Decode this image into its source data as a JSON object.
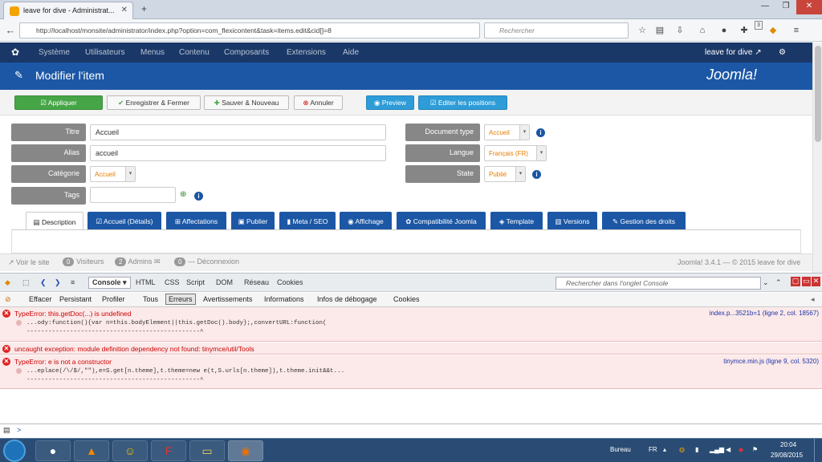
{
  "browser": {
    "tab_title": "leave for dive - Administrat...",
    "url": "http://localhost/monsite/administrator/index.php?option=com_flexicontent&task=items.edit&cid[]=8",
    "search_placeholder": "Rechercher",
    "badge_count": "3"
  },
  "joomla_menu": [
    "Système",
    "Utilisateurs",
    "Menus",
    "Contenu",
    "Composants",
    "Extensions",
    "Aide"
  ],
  "site_name": "leave for dive ↗",
  "page_title": "Modifier l'item",
  "brand": "Joomla!",
  "toolbar": {
    "apply": "Appliquer",
    "save_close": "Enregistrer & Fermer",
    "save_new": "Sauver & Nouveau",
    "cancel": "Annuler",
    "preview": "Preview",
    "edit_positions": "Editer les positions"
  },
  "form": {
    "title_label": "Titre",
    "title_value": "Accueil",
    "alias_label": "Alias",
    "alias_value": "accueil",
    "category_label": "Catégorie",
    "category_value": "Accueil",
    "tags_label": "Tags",
    "doctype_label": "Document type",
    "doctype_value": "Accueil",
    "language_label": "Langue",
    "language_value": "Français (FR)",
    "state_label": "State",
    "state_value": "Publié"
  },
  "tabs": [
    "Description",
    "Accueil (Détails)",
    "Affectations",
    "Publier",
    "Meta / SEO",
    "Affichage",
    "Compatibilité Joomla",
    "Template",
    "Versions",
    "Gestion des droits"
  ],
  "status": {
    "view_site": "Voir le site",
    "visitors_count": "0",
    "visitors": "Visiteurs",
    "admins_count": "2",
    "admins": "Admins",
    "messages_count": "0",
    "logout": "Déconnexion",
    "footer": "Joomla! 3.4.1 — © 2015 leave for dive"
  },
  "firebug": {
    "tabs": [
      "Console ▾",
      "HTML",
      "CSS",
      "Script",
      "DOM",
      "Réseau",
      "Cookies"
    ],
    "search_placeholder": "Rechercher dans l'onglet Console",
    "filters": [
      "Effacer",
      "Persistant",
      "Profiler",
      "Tous",
      "Erreurs",
      "Avertissements",
      "Informations",
      "Infos de débogage",
      "Cookies"
    ]
  },
  "errors": [
    {
      "msg": "TypeError: this.getDoc(...) is undefined",
      "src": "index.p...3521b=1 (ligne 2, col. 18567)",
      "code1": "...ody:function(){var n=this.bodyElement||this.getDoc().body};,convertURL:function(",
      "code2": "------------------------------------------------^"
    },
    {
      "msg": "uncaught exception: module definition dependency not found: tinymce/util/Tools",
      "src": "",
      "code1": "",
      "code2": ""
    },
    {
      "msg": "TypeError: e is not a constructor",
      "src": "tinymce.min.js (ligne 9, col. 5320)",
      "code1": "...eplace(/\\/$/,\"\"),e=S.get[n.theme],t.theme=new e(t,S.urls[n.theme]),t.theme.init&&t...",
      "code2": "------------------------------------------------^"
    }
  ],
  "cmd_prompt": ">",
  "taskbar": {
    "desktop": "Bureau",
    "lang": "FR",
    "time": "20:04",
    "date": "29/08/2015"
  }
}
